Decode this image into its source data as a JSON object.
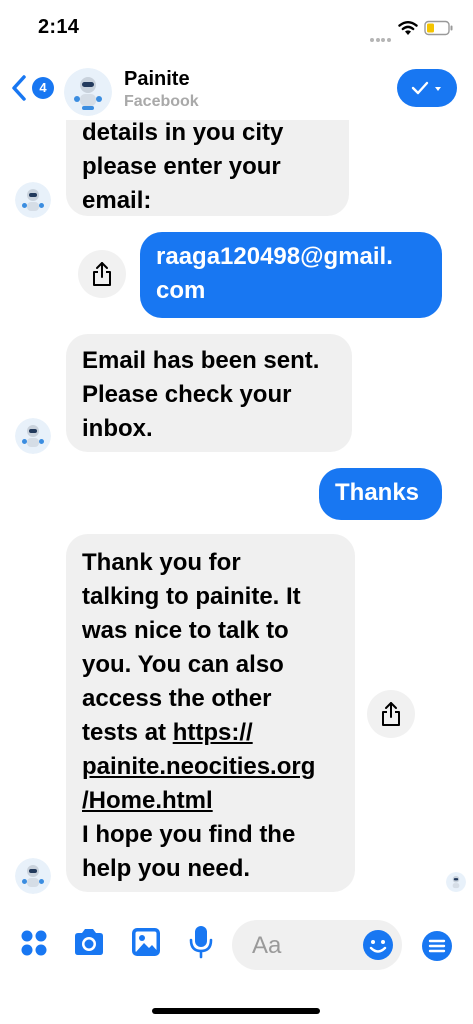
{
  "status_bar": {
    "time": "2:14"
  },
  "header": {
    "back_badge": "4",
    "contact_name": "Painite",
    "contact_sub": "Facebook"
  },
  "messages": [
    {
      "direction": "incoming",
      "lines": [
        "details in you city",
        "please enter your",
        "email:"
      ]
    },
    {
      "direction": "outgoing",
      "lines": [
        "raaga120498@gmail.",
        "com"
      ]
    },
    {
      "direction": "incoming",
      "lines": [
        "Email has been sent.",
        "Please check your",
        "inbox."
      ]
    },
    {
      "direction": "outgoing",
      "lines": [
        "Thanks"
      ]
    },
    {
      "direction": "incoming",
      "lines": [
        "Thank you for",
        "talking to painite. It",
        "was nice to talk to",
        "you. You can also",
        "access the other",
        "tests at "
      ],
      "link_lines": [
        "https://",
        "painite.neocities.org",
        "/Home.html"
      ],
      "after_lines": [
        "I hope you find the",
        "help you need."
      ]
    }
  ],
  "composer": {
    "placeholder": "Aa"
  },
  "colors": {
    "accent": "#1877f2",
    "incoming_bubble": "#f0f0f0",
    "subtle_text": "#a9a9a9"
  },
  "icons": [
    "wifi-icon",
    "battery-icon",
    "back-chevron-icon",
    "checkmark-icon",
    "share-icon",
    "apps-grid-icon",
    "camera-icon",
    "image-icon",
    "microphone-icon",
    "emoji-icon",
    "menu-icon"
  ]
}
